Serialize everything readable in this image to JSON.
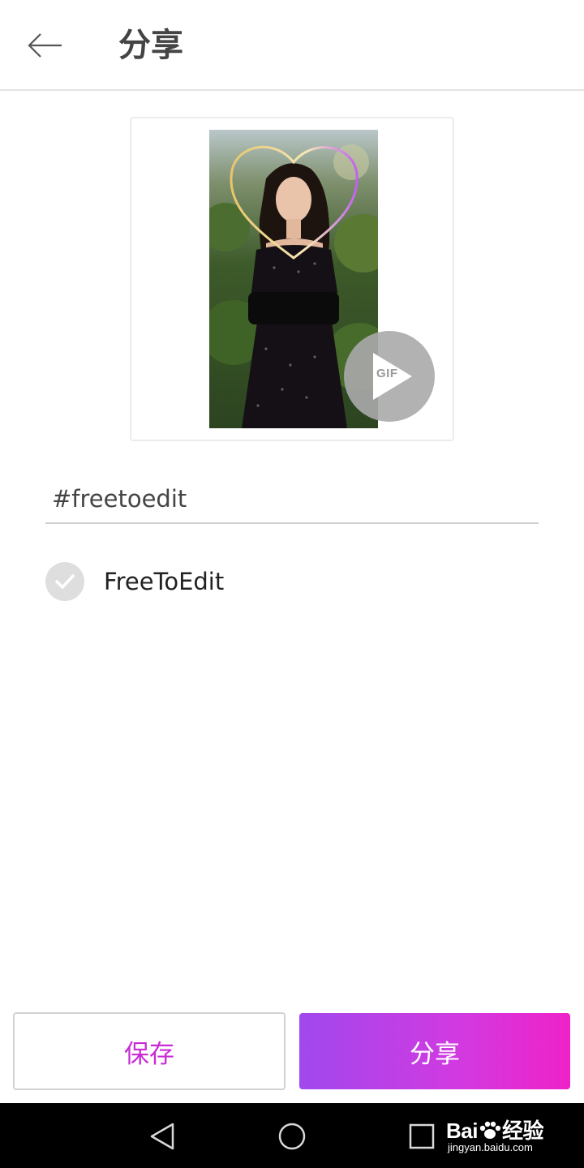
{
  "header": {
    "back_icon": "arrow-left-icon",
    "title": "分享"
  },
  "preview": {
    "description_icon": "gif-play-icon",
    "gif_label": "GIF"
  },
  "tags": {
    "value": "#freetoedit"
  },
  "free_to_edit": {
    "label": "FreeToEdit",
    "checked": true
  },
  "actions": {
    "save_label": "保存",
    "share_label": "分享"
  },
  "watermark": {
    "brand": "Bai 经验",
    "brand_left": "Bai",
    "brand_right": "经验",
    "url": "jingyan.baidu.com"
  },
  "colors": {
    "accent": "#c92bd6",
    "gradient_start": "#a048ee",
    "gradient_end": "#ee22c8",
    "check_bg": "#dedede"
  }
}
